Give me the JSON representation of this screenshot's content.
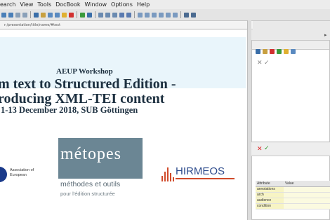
{
  "menubar": {
    "items": [
      "earch",
      "View",
      "Tools",
      "DocBook",
      "Window",
      "Options",
      "Help"
    ]
  },
  "pathbar": {
    "text": "r:/presentation/title/name/#text"
  },
  "slide": {
    "workshop": "AEUP Workshop",
    "title_line1": "m text to Structured Edition -",
    "title_line2": "roducing XML-TEI content",
    "date_line": "1-13 December 2018, SUB Göttingen"
  },
  "logos": {
    "aeup_text": "Association of European",
    "metopes_word": "métopes",
    "metopes_sub1": "méthodes et outils",
    "metopes_sub2": "pour l'édition structurée",
    "hirmeos_word": "HIRMEOS"
  },
  "attributes_panel": {
    "columns": [
      "Attribute",
      "Value"
    ],
    "rows": [
      {
        "attribute": "annotations",
        "value": ""
      },
      {
        "attribute": "arch",
        "value": ""
      },
      {
        "attribute": "audience",
        "value": ""
      },
      {
        "attribute": "condition",
        "value": ""
      }
    ]
  },
  "colors": {
    "title_bg": "#e9f5fb",
    "metopes_bg": "#6b8694",
    "hirmeos_blue": "#2d4b8c",
    "hirmeos_red": "#d04a2a",
    "attr_row_bg": "#f7f4c4"
  }
}
